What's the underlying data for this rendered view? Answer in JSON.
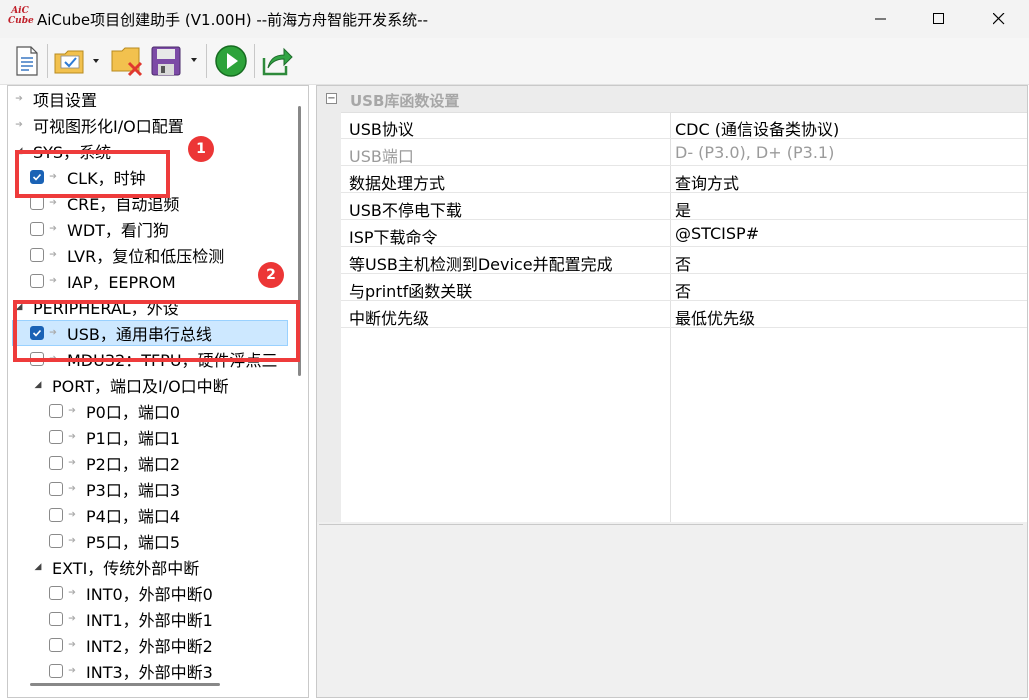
{
  "window": {
    "title": "AiCube项目创建助手 (V1.00H) --前海方舟智能开发系统--",
    "logo_top": "AiC",
    "logo_bottom": "Cube"
  },
  "toolbar": {
    "buttons": [
      "new-project",
      "open-project",
      "close-project",
      "save-project",
      "run",
      "export"
    ]
  },
  "tree": {
    "items": [
      {
        "label": "项目设置",
        "kind": "root"
      },
      {
        "label": "可视图形化I/O口配置",
        "kind": "root"
      },
      {
        "label": "SYS，系统",
        "kind": "group"
      },
      {
        "label": "CLK，时钟",
        "kind": "check",
        "checked": true
      },
      {
        "label": "CRE，自动追频",
        "kind": "check",
        "checked": false
      },
      {
        "label": "WDT，看门狗",
        "kind": "check",
        "checked": false
      },
      {
        "label": "LVR，复位和低压检测",
        "kind": "check",
        "checked": false
      },
      {
        "label": "IAP，EEPROM",
        "kind": "check",
        "checked": false
      },
      {
        "label": "PERIPHERAL，外设",
        "kind": "group"
      },
      {
        "label": "USB，通用串行总线",
        "kind": "check",
        "checked": true,
        "selected": true
      },
      {
        "label": "MDU32：TFPU，硬件浮点三",
        "kind": "check",
        "checked": false
      },
      {
        "label": "PORT，端口及I/O口中断",
        "kind": "subgroup"
      },
      {
        "label": "P0口，端口0",
        "kind": "subcheck",
        "checked": false
      },
      {
        "label": "P1口，端口1",
        "kind": "subcheck",
        "checked": false
      },
      {
        "label": "P2口，端口2",
        "kind": "subcheck",
        "checked": false
      },
      {
        "label": "P3口，端口3",
        "kind": "subcheck",
        "checked": false
      },
      {
        "label": "P4口，端口4",
        "kind": "subcheck",
        "checked": false
      },
      {
        "label": "P5口，端口5",
        "kind": "subcheck",
        "checked": false
      },
      {
        "label": "EXTI，传统外部中断",
        "kind": "subgroup"
      },
      {
        "label": "INT0，外部中断0",
        "kind": "subcheck",
        "checked": false
      },
      {
        "label": "INT1，外部中断1",
        "kind": "subcheck",
        "checked": false
      },
      {
        "label": "INT2，外部中断2",
        "kind": "subcheck",
        "checked": false
      },
      {
        "label": "INT3，外部中断3",
        "kind": "subcheck",
        "checked": false
      }
    ]
  },
  "annotations": {
    "badge1": "1",
    "badge2": "2",
    "color": "#ee3b3b"
  },
  "properties": {
    "category": "USB库函数设置",
    "rows": [
      {
        "name": "USB协议",
        "value": "CDC (通信设备类协议)",
        "disabled": false
      },
      {
        "name": "USB端口",
        "value": "D- (P3.0), D+ (P3.1)",
        "disabled": true
      },
      {
        "name": "数据处理方式",
        "value": "查询方式",
        "disabled": false
      },
      {
        "name": "USB不停电下载",
        "value": "是",
        "disabled": false
      },
      {
        "name": "ISP下载命令",
        "value": "@STCISP#",
        "disabled": false
      },
      {
        "name": "等USB主机检测到Device并配置完成",
        "value": "否",
        "disabled": false
      },
      {
        "name": "与printf函数关联",
        "value": "否",
        "disabled": false
      },
      {
        "name": "中断优先级",
        "value": "最低优先级",
        "disabled": false
      }
    ]
  }
}
